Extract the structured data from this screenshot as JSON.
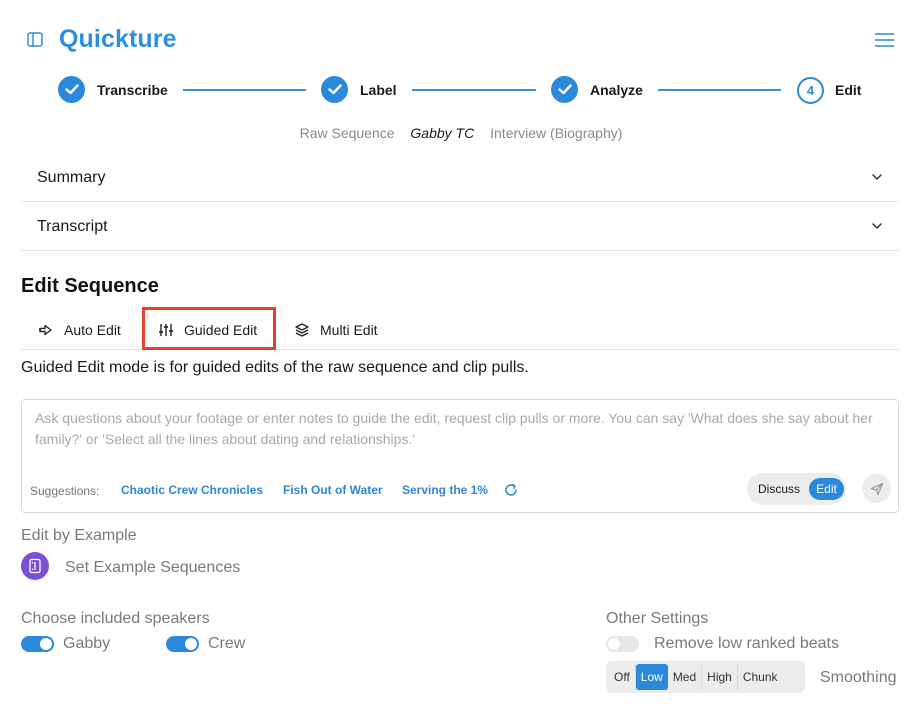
{
  "app": {
    "title": "Quickture"
  },
  "stepper": {
    "steps": [
      {
        "label": "Transcribe",
        "state": "done"
      },
      {
        "label": "Label",
        "state": "done"
      },
      {
        "label": "Analyze",
        "state": "done"
      },
      {
        "label": "Edit",
        "state": "current",
        "number": "4"
      }
    ]
  },
  "breadcrumb": {
    "items": [
      "Raw Sequence",
      "Gabby TC",
      "Interview (Biography)"
    ],
    "active_index": 1
  },
  "accordions": {
    "summary": "Summary",
    "transcript": "Transcript"
  },
  "edit_sequence": {
    "title": "Edit Sequence",
    "tabs": [
      {
        "label": "Auto Edit",
        "icon": "arrow-right-icon"
      },
      {
        "label": "Guided Edit",
        "icon": "sliders-icon",
        "selected": true
      },
      {
        "label": "Multi Edit",
        "icon": "layers-icon"
      }
    ],
    "mode_description": "Guided Edit mode is for guided edits of the raw sequence and clip pulls."
  },
  "prompt": {
    "placeholder": "Ask questions about your footage or enter notes to guide the edit, request clip pulls or more. You can say 'What does she say about her family?' or 'Select all the lines about dating and relationships.'",
    "suggestions_label": "Suggestions:",
    "suggestions": [
      "Chaotic Crew Chronicles",
      "Fish Out of Water",
      "Serving the 1%"
    ],
    "mode_discuss": "Discuss",
    "mode_edit": "Edit",
    "mode_selected": "Edit"
  },
  "edit_by_example": {
    "label": "Edit by Example",
    "action": "Set Example Sequences"
  },
  "speakers": {
    "label": "Choose included speakers",
    "items": [
      {
        "name": "Gabby",
        "on": true
      },
      {
        "name": "Crew",
        "on": true
      }
    ]
  },
  "other_settings": {
    "label": "Other Settings",
    "remove_low_ranked": {
      "label": "Remove low ranked beats",
      "on": false
    },
    "smoothing": {
      "label": "Smoothing",
      "options": [
        "Off",
        "Low",
        "Med",
        "High",
        "Chunk"
      ],
      "selected": "Low"
    }
  },
  "colors": {
    "accent": "#2b89dc",
    "highlight_border": "#e5402a",
    "example_icon_bg": "#7b4fd6"
  }
}
